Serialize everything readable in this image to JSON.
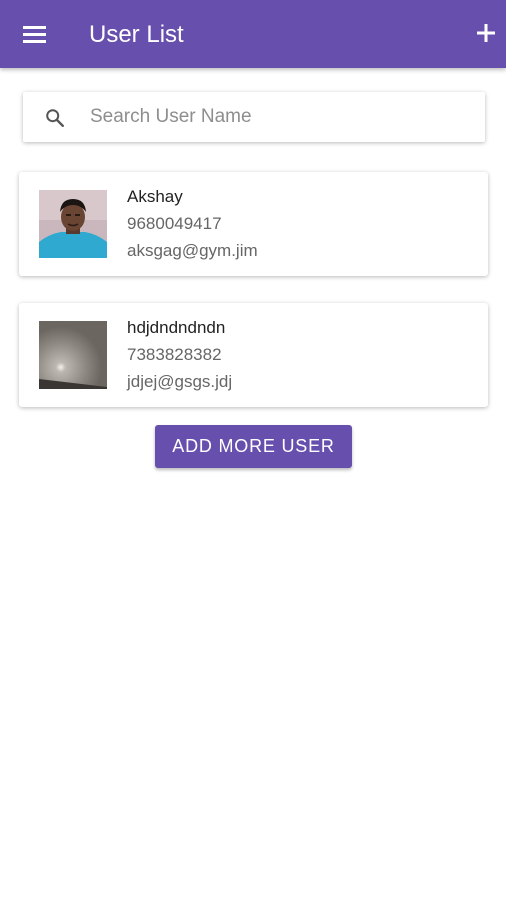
{
  "app_bar": {
    "title": "User List",
    "menu_icon": "hamburger-menu-icon",
    "add_icon": "plus-icon",
    "color": "#6750ad"
  },
  "search": {
    "icon": "search-icon",
    "placeholder": "Search User Name",
    "value": ""
  },
  "users": [
    {
      "name": "Akshay",
      "phone": "9680049417",
      "email": "aksgag@gym.jim",
      "avatar": "user-photo"
    },
    {
      "name": "hdjdndndndn",
      "phone": "7383828382",
      "email": "jdjej@gsgs.jdj",
      "avatar": "user-photo"
    }
  ],
  "add_more_button": {
    "label": "ADD MORE USER"
  }
}
